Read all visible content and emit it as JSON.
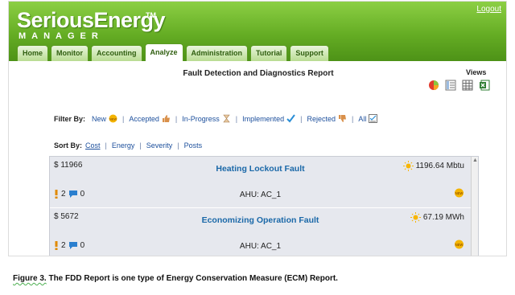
{
  "app": {
    "logo_main": "SeriousEnergy",
    "logo_tm": "TM",
    "logo_sub": "MANAGER",
    "logout": "Logout"
  },
  "nav": {
    "tabs": [
      {
        "label": "Home",
        "active": false
      },
      {
        "label": "Monitor",
        "active": false
      },
      {
        "label": "Accounting",
        "active": false
      },
      {
        "label": "Analyze",
        "active": true
      },
      {
        "label": "Administration",
        "active": false
      },
      {
        "label": "Tutorial",
        "active": false
      },
      {
        "label": "Support",
        "active": false
      }
    ]
  },
  "report": {
    "title": "Fault Detection and Diagnostics Report",
    "views_label": "Views"
  },
  "filter": {
    "label": "Filter By:",
    "items": [
      "New",
      "Accepted",
      "In-Progress",
      "Implemented",
      "Rejected",
      "All"
    ]
  },
  "sort": {
    "label": "Sort By:",
    "items": [
      "Cost",
      "Energy",
      "Severity",
      "Posts"
    ],
    "active": "Cost"
  },
  "faults": [
    {
      "cost": "$ 11966",
      "title": "Heating Lockout Fault",
      "energy": "1196.64 Mbtu",
      "severity_count": "2",
      "posts_count": "0",
      "equipment": "AHU: AC_1"
    },
    {
      "cost": "$ 5672",
      "title": "Economizing Operation Fault",
      "energy": "67.19 MWh",
      "severity_count": "2",
      "posts_count": "0",
      "equipment": "AHU: AC_1"
    }
  ],
  "caption": {
    "fig": "Figure 3.",
    "text": " The FDD Report is one type of Energy Conservation Measure (ECM) Report."
  },
  "colors": {
    "header_green": "#65ad24",
    "link_blue": "#1c4f9c",
    "title_blue": "#1a68a8",
    "card_bg": "#e6e8ee"
  }
}
